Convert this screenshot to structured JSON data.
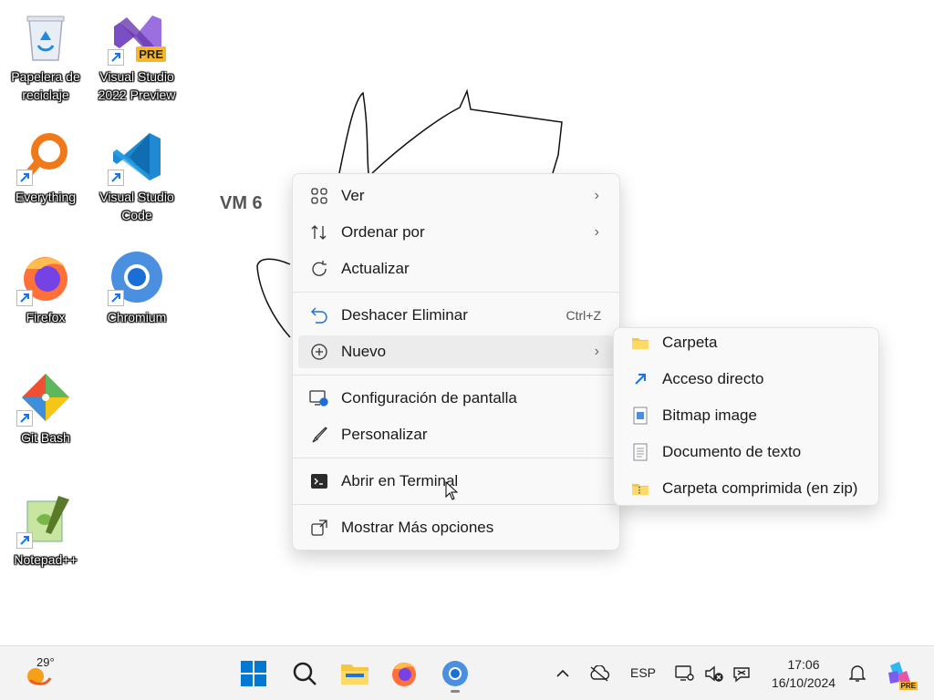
{
  "desktop": {
    "icons": [
      {
        "label": "Papelera de reciclaje"
      },
      {
        "label": "Visual Studio 2022 Preview",
        "badge": "PRE"
      },
      {
        "label": "Everything"
      },
      {
        "label": "Visual Studio Code"
      },
      {
        "label": "Firefox"
      },
      {
        "label": "Chromium"
      },
      {
        "label": "Git Bash"
      },
      {
        "label": "Notepad++"
      }
    ],
    "wallpaper_label": "VM 6"
  },
  "context_menu": {
    "items": [
      {
        "label": "Ver",
        "icon": "grid-icon",
        "has_submenu": true
      },
      {
        "label": "Ordenar por",
        "icon": "sort-icon",
        "has_submenu": true
      },
      {
        "label": "Actualizar",
        "icon": "refresh-icon"
      },
      {
        "label": "Deshacer Eliminar",
        "icon": "undo-icon",
        "shortcut": "Ctrl+Z"
      },
      {
        "label": "Nuevo",
        "icon": "plus-circle-icon",
        "has_submenu": true,
        "highlighted": true
      },
      {
        "label": "Configuración de pantalla",
        "icon": "display-settings-icon"
      },
      {
        "label": "Personalizar",
        "icon": "brush-icon"
      },
      {
        "label": "Abrir en Terminal",
        "icon": "terminal-icon"
      },
      {
        "label": "Mostrar Más opciones",
        "icon": "more-options-icon"
      }
    ],
    "chevron": "›"
  },
  "submenu_nuevo": {
    "items": [
      {
        "label": "Carpeta",
        "icon": "folder-icon"
      },
      {
        "label": "Acceso directo",
        "icon": "shortcut-icon"
      },
      {
        "label": "Bitmap image",
        "icon": "bitmap-icon"
      },
      {
        "label": "Documento de texto",
        "icon": "text-document-icon"
      },
      {
        "label": "Carpeta comprimida (en zip)",
        "icon": "zip-folder-icon"
      }
    ]
  },
  "taskbar": {
    "weather_temp": "29°",
    "language": "ESP",
    "time": "17:06",
    "date": "16/10/2024",
    "copilot_badge": "PRE"
  },
  "colors": {
    "accent": "#0067c0",
    "menu_bg": "#f9f9f9",
    "taskbar_bg": "#f3f3f3"
  }
}
